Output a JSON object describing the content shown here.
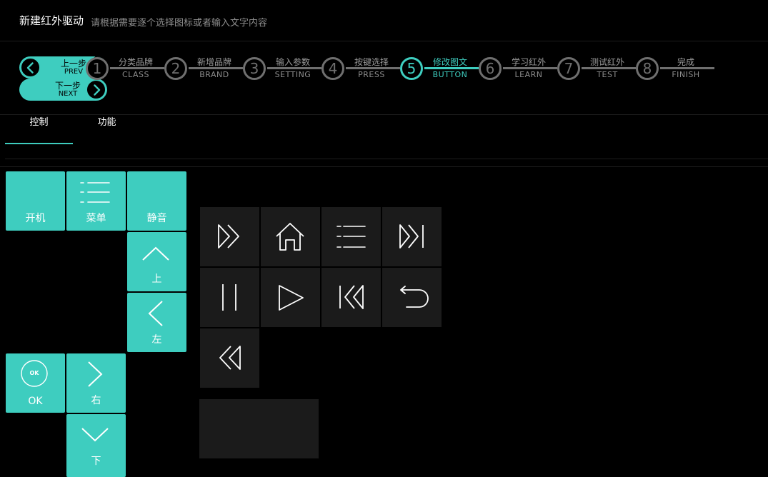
{
  "header": {
    "title": "新建红外驱动",
    "subtitle": "请根据需要逐个选择图标或者输入文字内容"
  },
  "nav": {
    "prev_zh": "上一步",
    "prev_en": "PREV",
    "next_zh": "下一步",
    "next_en": "NEXT"
  },
  "steps": [
    {
      "num": "1",
      "zh": "分类品牌",
      "en": "CLASS"
    },
    {
      "num": "2",
      "zh": "新增品牌",
      "en": "BRAND"
    },
    {
      "num": "3",
      "zh": "输入参数",
      "en": "SETTING"
    },
    {
      "num": "4",
      "zh": "按键选择",
      "en": "PRESS"
    },
    {
      "num": "5",
      "zh": "修改图文",
      "en": "BUTTON"
    },
    {
      "num": "6",
      "zh": "学习红外",
      "en": "LEARN"
    },
    {
      "num": "7",
      "zh": "测试红外",
      "en": "TEST"
    },
    {
      "num": "8",
      "zh": "完成",
      "en": "FINISH"
    }
  ],
  "active_step": 5,
  "tabs": [
    {
      "label": "控制"
    },
    {
      "label": "功能"
    }
  ],
  "keys": {
    "power": "开机",
    "menu": "菜单",
    "mute": "静音",
    "up": "上",
    "left": "左",
    "ok_badge": "OK",
    "ok": "OK",
    "right": "右",
    "down": "下"
  },
  "media_icons": [
    "fast-forward-icon",
    "home-icon",
    "list-icon",
    "skip-next-icon",
    "pause-icon",
    "play-icon",
    "skip-previous-icon",
    "return-icon",
    "rewind-icon"
  ],
  "colors": {
    "accent": "#3ecdbf",
    "tile_dark": "#1b1b1b",
    "background": "#000000"
  }
}
